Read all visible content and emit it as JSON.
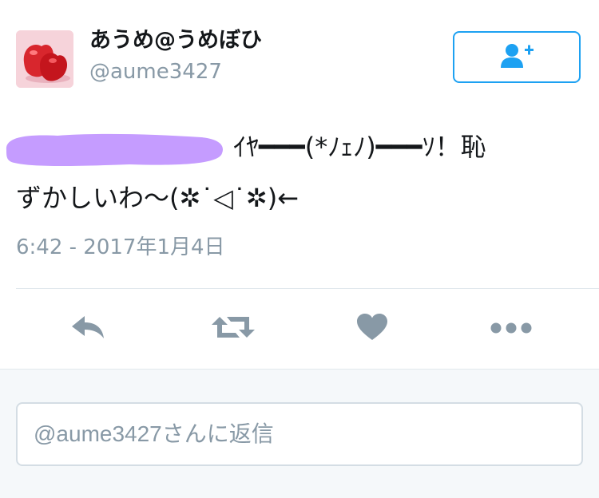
{
  "user": {
    "display_name": "あうめ@うめぼひ",
    "handle": "@aume3427"
  },
  "tweet": {
    "line1_text": "ｲﾔ━━━(*ﾉｪﾉ)━━━ｿ！恥",
    "line2_text": "ずかしいわ〜(✲˙◁˙✲)←",
    "timestamp": "6:42 - 2017年1月4日"
  },
  "actions": {
    "icons": [
      "reply-icon",
      "retweet-icon",
      "like-icon",
      "more-icon"
    ],
    "color": "#8899a6"
  },
  "reply": {
    "placeholder": "@aume3427さんに返信"
  },
  "colors": {
    "accent": "#1da1f2",
    "text": "#14171a",
    "muted": "#8899a6",
    "redaction": "#c59cff"
  }
}
